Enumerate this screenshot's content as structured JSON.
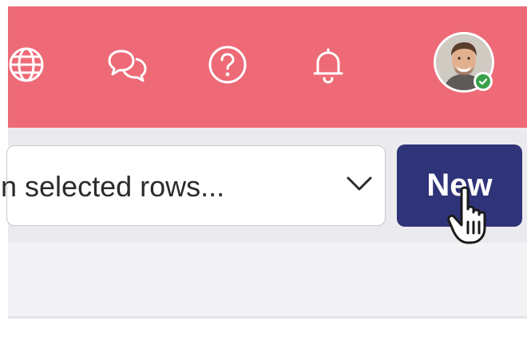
{
  "header": {
    "background": "#ee6a77",
    "icons": [
      "globe-icon",
      "chat-icon",
      "help-icon",
      "bell-icon"
    ],
    "user": {
      "avatar": "avatar",
      "status_color": "#3aa04a"
    }
  },
  "toolbar": {
    "bulk_action_select": {
      "value": "n selected rows..."
    },
    "new_button": {
      "label": "New",
      "color": "#2f3378"
    }
  }
}
